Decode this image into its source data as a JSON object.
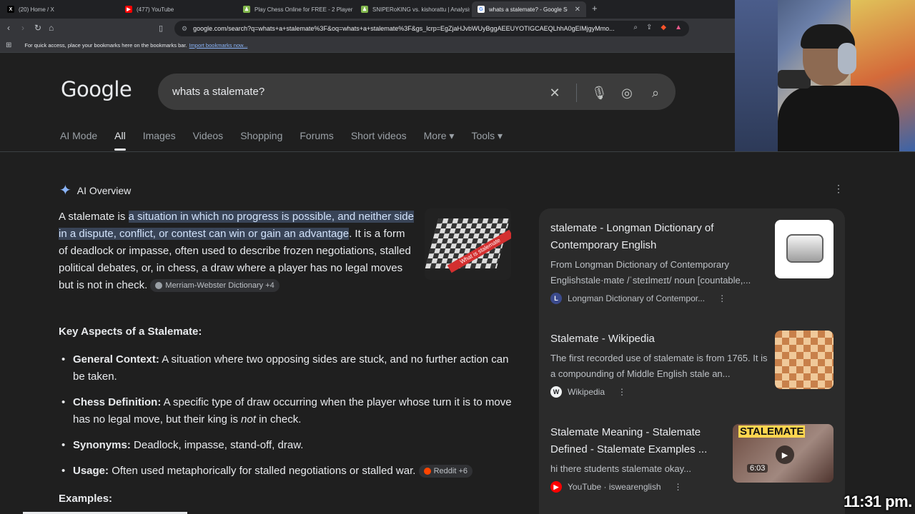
{
  "browser": {
    "tabs": [
      {
        "label": "(20) Home / X",
        "icon": "x-logo-icon",
        "color": "#ffffff"
      },
      {
        "label": "(477) YouTube",
        "icon": "youtube-icon",
        "color": "#ff0000"
      },
      {
        "label": "Play Chess Online for FREE - 2 Player",
        "icon": "chess-pawn-icon",
        "color": "#81b64c"
      },
      {
        "label": "SNIPERoKING vs. kishorattu | Analysis",
        "icon": "chess-pawn-icon",
        "color": "#81b64c"
      },
      {
        "label": "whats a stalemate? - Google Search",
        "icon": "google-icon",
        "color": "#4285f4"
      }
    ],
    "url": "google.com/search?q=whats+a+stalemate%3F&oq=whats+a+stalemate%3F&gs_lcrp=EgZjaHJvbWUyBggAEEUYOTIGCAEQLhhA0gEIMjgyMmo...",
    "bookmarks_text": "For quick access, place your bookmarks here on the bookmarks bar.",
    "bookmarks_link": "Import bookmarks now..."
  },
  "search": {
    "logo": "Google",
    "query": "whats a stalemate?"
  },
  "nav_tabs": [
    "AI Mode",
    "All",
    "Images",
    "Videos",
    "Shopping",
    "Forums",
    "Short videos",
    "More ▾",
    "Tools ▾"
  ],
  "ai_overview": {
    "label": "AI Overview",
    "intro_prefix": "A stalemate is ",
    "intro_highlight": "a situation in which no progress is possible, and neither side in a dispute, conflict, or contest can win or gain an advantage",
    "intro_rest": ". It is a form of deadlock or impasse, often used to describe frozen negotiations, stalled political debates, or, in chess, a draw where a player has no legal moves but is not in check.",
    "source_chip": "Merriam-Webster Dictionary +4",
    "thumb_caption": "What is stalemate",
    "heading": "Key Aspects of a Stalemate:",
    "bullets": [
      {
        "term": "General Context:",
        "text": " A situation where two opposing sides are stuck, and no further action can be taken."
      },
      {
        "term": "Chess Definition:",
        "text": " A specific type of draw occurring when the player whose turn it is to move has no legal move, but their king is ",
        "em": "not",
        "tail": " in check."
      },
      {
        "term": "Synonyms:",
        "text": " Deadlock, impasse, stand-off, draw."
      },
      {
        "term": "Usage:",
        "text": " Often used metaphorically for stalled negotiations or stalled war.",
        "chip": "Reddit +6"
      }
    ],
    "examples_heading": "Examples:"
  },
  "sources": [
    {
      "title": "stalemate - Longman Dictionary of Contemporary English",
      "snippet": "From Longman Dictionary of Contemporary Englishstale·mate /ˈsteɪlmeɪt/ noun [countable,...",
      "site": "Longman Dictionary of Contempor..."
    },
    {
      "title": "Stalemate - Wikipedia",
      "snippet": "The first recorded use of stalemate is from 1765. It is a compounding of Middle English stale an...",
      "site": "Wikipedia"
    },
    {
      "title": "Stalemate Meaning - Stalemate Defined - Stalemate Examples ...",
      "snippet": "hi there students stalemate okay...",
      "site": "YouTube · iswearenglish",
      "duration": "6:03",
      "thumb_word": "STALEMATE"
    }
  ],
  "overlay": {
    "clock": "11:31 pm."
  },
  "colors": {
    "page_bg": "#1f1f1f",
    "highlight_bg": "#394457",
    "link": "#8ab4f8"
  }
}
